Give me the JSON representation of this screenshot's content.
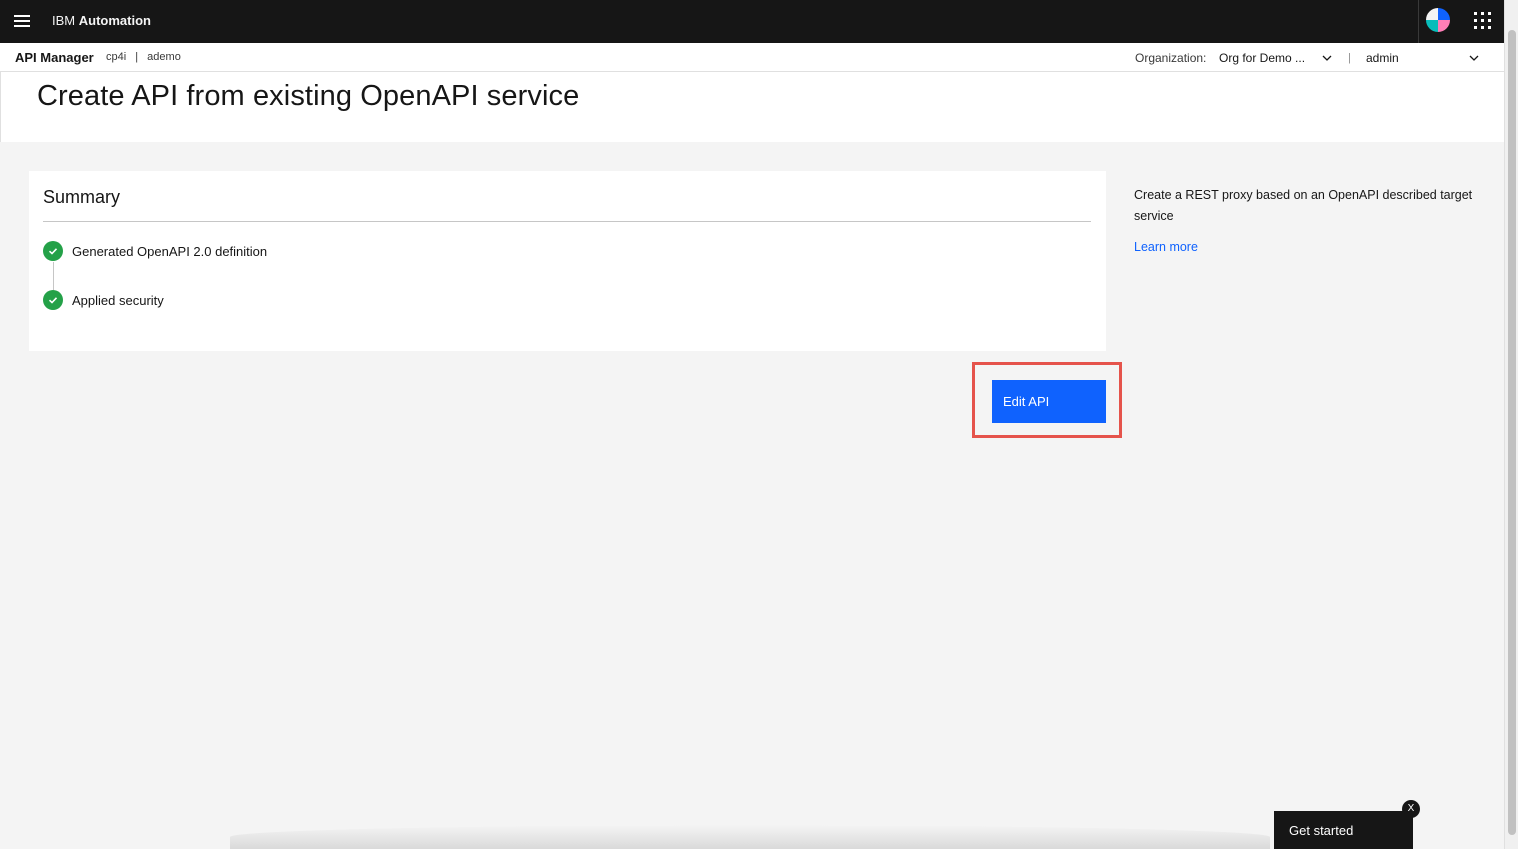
{
  "topbar": {
    "brand_prefix": "IBM",
    "brand_name": "Automation",
    "menu_icon": "hamburger-menu-icon",
    "apps_icon": "app-switcher-icon"
  },
  "subheader": {
    "app_name": "API Manager",
    "catalog": "cp4i",
    "separator": "|",
    "provider": "ademo",
    "org_label": "Organization:",
    "org_value": "Org for Demo ...",
    "divider": "|",
    "user": "admin"
  },
  "page": {
    "title": "Create API from existing OpenAPI service"
  },
  "summary": {
    "title": "Summary",
    "steps": [
      {
        "label": "Generated OpenAPI 2.0 definition",
        "status": "complete"
      },
      {
        "label": "Applied security",
        "status": "complete"
      }
    ]
  },
  "sidebar": {
    "description": "Create a REST proxy based on an OpenAPI described target service",
    "learn_more": "Learn more"
  },
  "actions": {
    "edit_api": "Edit API"
  },
  "get_started": {
    "label": "Get started",
    "close": "X"
  },
  "colors": {
    "primary": "#0f62fe",
    "success": "#24a148",
    "header_bg": "#161616",
    "highlight": "#e5534b"
  }
}
